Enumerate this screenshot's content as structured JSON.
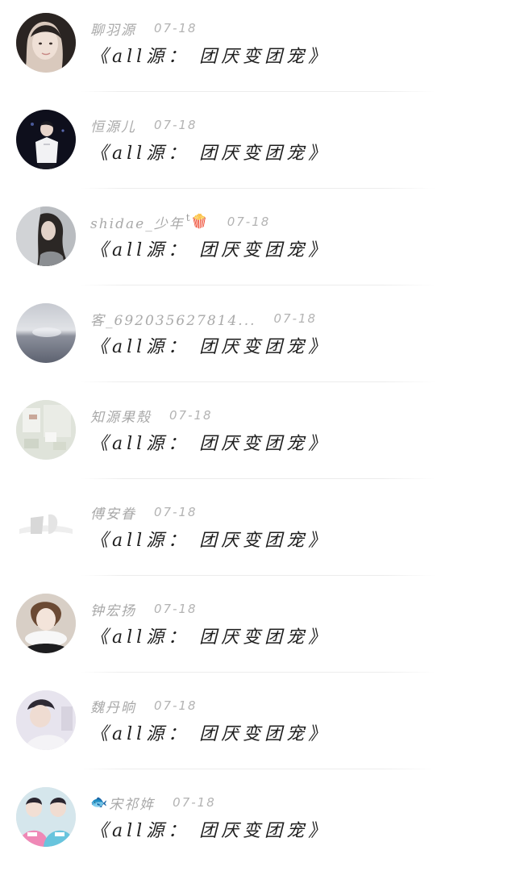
{
  "comments": [
    {
      "username": "聊羽源",
      "date": "07-18",
      "title": "《all源： 团厌变团宠》",
      "avatar_icon": "girl-portrait-avatar"
    },
    {
      "username": "恒源儿",
      "date": "07-18",
      "title": "《all源： 团厌变团宠》",
      "avatar_icon": "stage-performer-avatar"
    },
    {
      "username": "shidae_少年",
      "emoji": "🍿",
      "date": "07-18",
      "title": "《all源： 团厌变团宠》",
      "avatar_icon": "long-hair-girl-avatar"
    },
    {
      "username": "客_692035627814...",
      "date": "07-18",
      "title": "《all源： 团厌变团宠》",
      "avatar_icon": "misty-sea-avatar"
    },
    {
      "username": "知源果殼",
      "date": "07-18",
      "title": "《all源： 团厌变团宠》",
      "avatar_icon": "room-interior-avatar"
    },
    {
      "username": "傅安眷",
      "date": "07-18",
      "title": "《all源： 团厌变团宠》",
      "avatar_icon": "faded-sketch-avatar"
    },
    {
      "username": "钟宏扬",
      "date": "07-18",
      "title": "《all源： 团厌变团宠》",
      "avatar_icon": "fur-collar-portrait-avatar"
    },
    {
      "username": "魏丹晌",
      "date": "07-18",
      "title": "《all源： 团厌变团宠》",
      "avatar_icon": "boy-profile-avatar"
    },
    {
      "username": "宋祁姩",
      "emoji": "🐟",
      "date": "07-18",
      "title": "《all源： 团厌变团宠》",
      "avatar_icon": "two-friends-avatar"
    }
  ]
}
